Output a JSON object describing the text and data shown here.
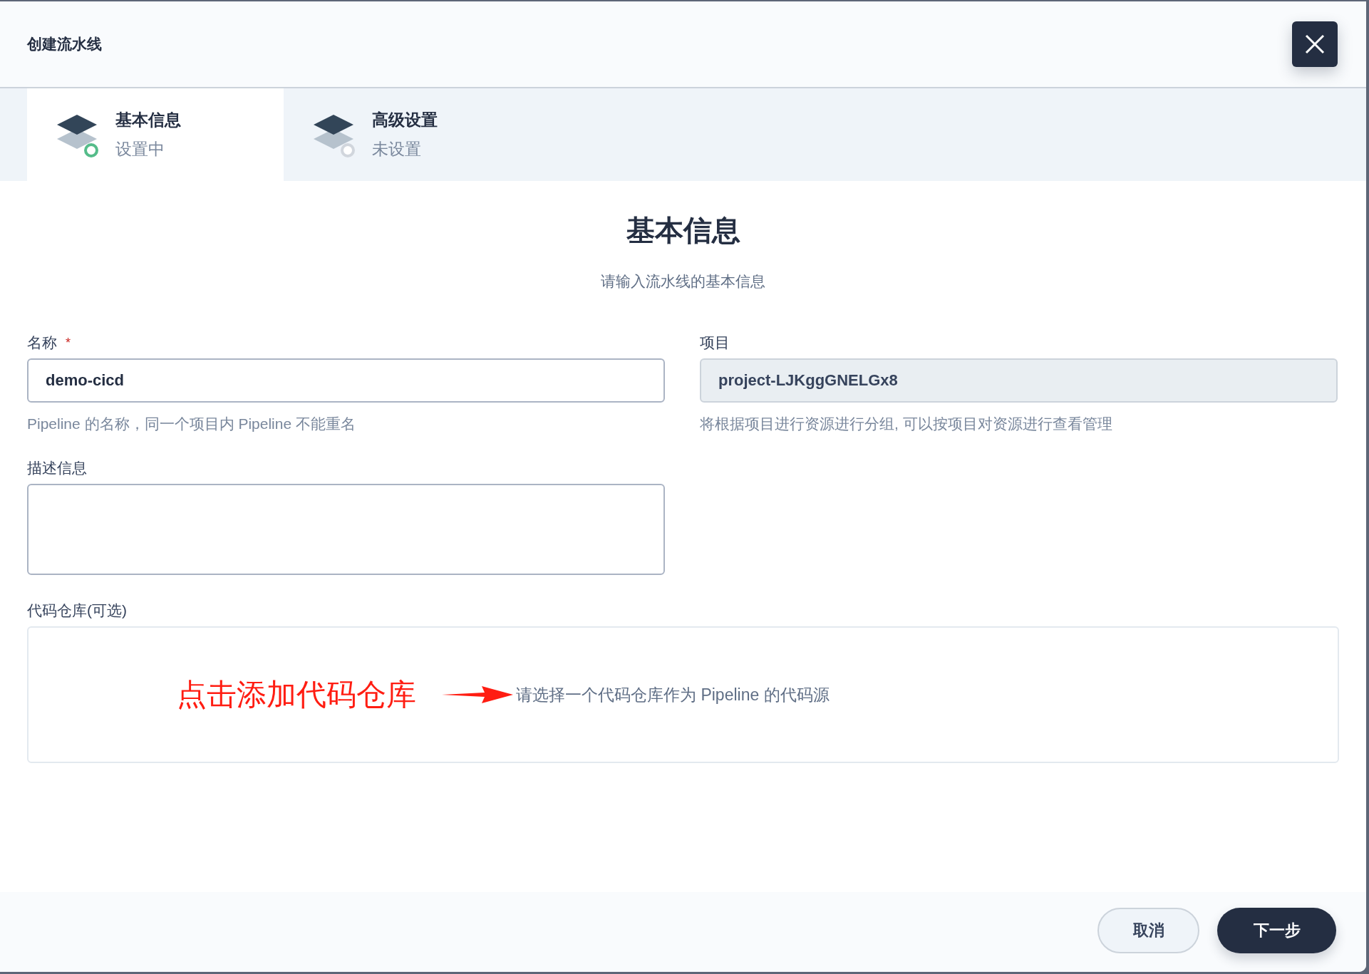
{
  "dialog": {
    "title": "创建流水线"
  },
  "steps": [
    {
      "title": "基本信息",
      "status": "设置中",
      "selected": true
    },
    {
      "title": "高级设置",
      "status": "未设置",
      "selected": false
    }
  ],
  "section": {
    "title": "基本信息",
    "subtitle": "请输入流水线的基本信息"
  },
  "fields": {
    "name": {
      "label": "名称",
      "required_mark": "*",
      "value": "demo-cicd",
      "hint": "Pipeline 的名称，同一个项目内 Pipeline 不能重名"
    },
    "project": {
      "label": "项目",
      "value": "project-LJKggGNELGx8",
      "disabled": true,
      "hint": "将根据项目进行资源进行分组, 可以按项目对资源进行查看管理"
    },
    "description": {
      "label": "描述信息"
    },
    "repository": {
      "label": "代码仓库(可选)",
      "prompt": "请选择一个代码仓库作为 Pipeline 的代码源"
    }
  },
  "annotation": {
    "text": "点击添加代码仓库"
  },
  "buttons": [
    {
      "label": "取消",
      "kind": "secondary"
    },
    {
      "label": "下一步",
      "kind": "primary"
    }
  ]
}
